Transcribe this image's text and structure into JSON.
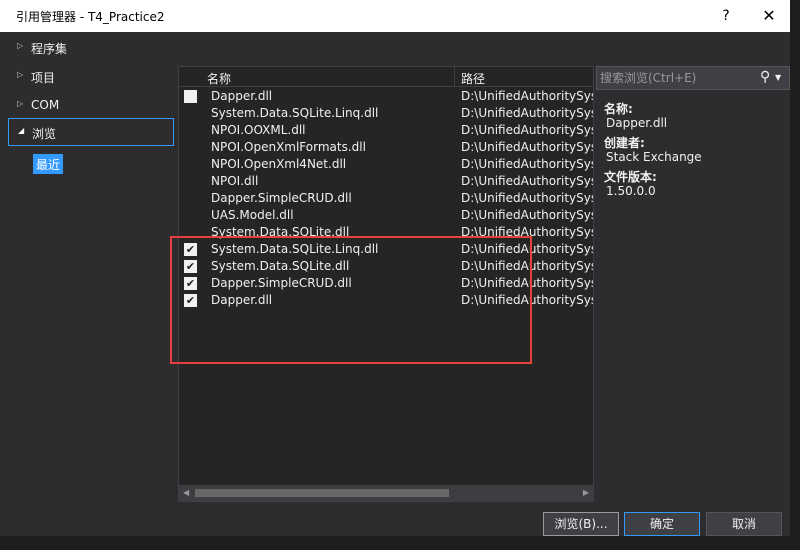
{
  "window": {
    "title": "引用管理器 - T4_Practice2",
    "help_label": "?",
    "close_label": "✕"
  },
  "nav": {
    "items": [
      {
        "label": "程序集",
        "arrow": "▷"
      },
      {
        "label": "项目",
        "arrow": "▷"
      },
      {
        "label": "COM",
        "arrow": "▷"
      },
      {
        "label": "浏览",
        "arrow": "◢"
      }
    ],
    "sub_item": "最近"
  },
  "list": {
    "columns": [
      "名称",
      "路径"
    ],
    "rows": [
      {
        "name": "Dapper.dll",
        "path": "D:\\UnifiedAuthoritySyst",
        "checkbox": "empty"
      },
      {
        "name": "System.Data.SQLite.Linq.dll",
        "path": "D:\\UnifiedAuthoritySyst",
        "checkbox": "none"
      },
      {
        "name": "NPOI.OOXML.dll",
        "path": "D:\\UnifiedAuthoritySyst",
        "checkbox": "none"
      },
      {
        "name": "NPOI.OpenXmlFormats.dll",
        "path": "D:\\UnifiedAuthoritySyst",
        "checkbox": "none"
      },
      {
        "name": "NPOI.OpenXml4Net.dll",
        "path": "D:\\UnifiedAuthoritySyst",
        "checkbox": "none"
      },
      {
        "name": "NPOI.dll",
        "path": "D:\\UnifiedAuthoritySyst",
        "checkbox": "none"
      },
      {
        "name": "Dapper.SimpleCRUD.dll",
        "path": "D:\\UnifiedAuthoritySyst",
        "checkbox": "none"
      },
      {
        "name": "UAS.Model.dll",
        "path": "D:\\UnifiedAuthoritySyst",
        "checkbox": "none"
      },
      {
        "name": "System.Data.SQLite.dll",
        "path": "D:\\UnifiedAuthoritySyst",
        "checkbox": "none"
      },
      {
        "name": "System.Data.SQLite.Linq.dll",
        "path": "D:\\UnifiedAuthoritySyst",
        "checkbox": "checked"
      },
      {
        "name": "System.Data.SQLite.dll",
        "path": "D:\\UnifiedAuthoritySyst",
        "checkbox": "checked"
      },
      {
        "name": "Dapper.SimpleCRUD.dll",
        "path": "D:\\UnifiedAuthoritySyst",
        "checkbox": "checked"
      },
      {
        "name": "Dapper.dll",
        "path": "D:\\UnifiedAuthoritySyst",
        "checkbox": "checked"
      }
    ]
  },
  "search": {
    "placeholder": "搜索浏览(Ctrl+E)"
  },
  "details": {
    "name_label": "名称:",
    "name_value": "Dapper.dll",
    "creator_label": "创建者:",
    "creator_value": "Stack Exchange",
    "version_label": "文件版本:",
    "version_value": "1.50.0.0"
  },
  "buttons": {
    "browse": "浏览(B)...",
    "ok": "确定",
    "cancel": "取消"
  },
  "colors": {
    "accent": "#3399ff",
    "highlight_box": "#e8403d",
    "background": "#2d2d30"
  }
}
